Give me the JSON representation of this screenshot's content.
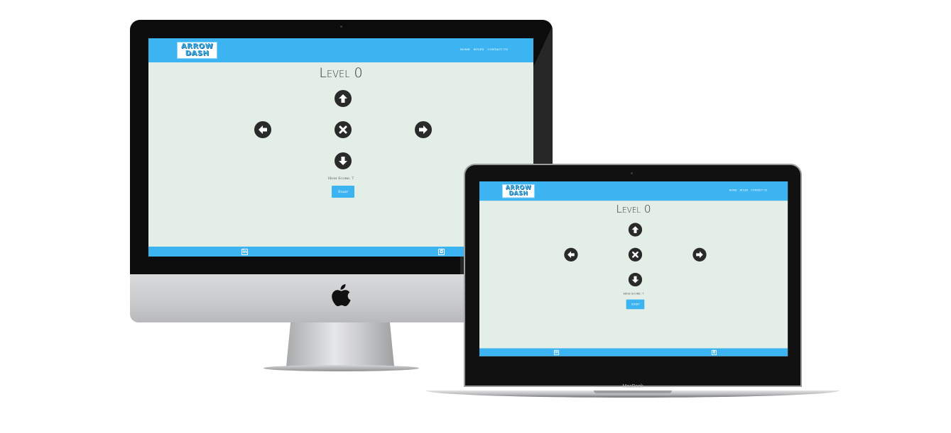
{
  "app": {
    "logo": {
      "line1": "ARROW",
      "line2": "DASH"
    },
    "nav": [
      "Home",
      "Rules",
      "Contact Us"
    ],
    "level_title": "Level 0",
    "arrows": {
      "up": "arrow-up-icon",
      "left": "arrow-left-icon",
      "center": "close-icon",
      "right": "arrow-right-icon",
      "down": "arrow-down-icon"
    },
    "high_score": "High Score: 7",
    "start_label": "Start",
    "footer_icons": [
      "linkedin-icon",
      "github-icon"
    ]
  },
  "devices": {
    "laptop_label": "MacBook"
  },
  "colors": {
    "accent": "#3db4f2",
    "background": "#e3eee7",
    "arrow": "#2a2a2a"
  }
}
